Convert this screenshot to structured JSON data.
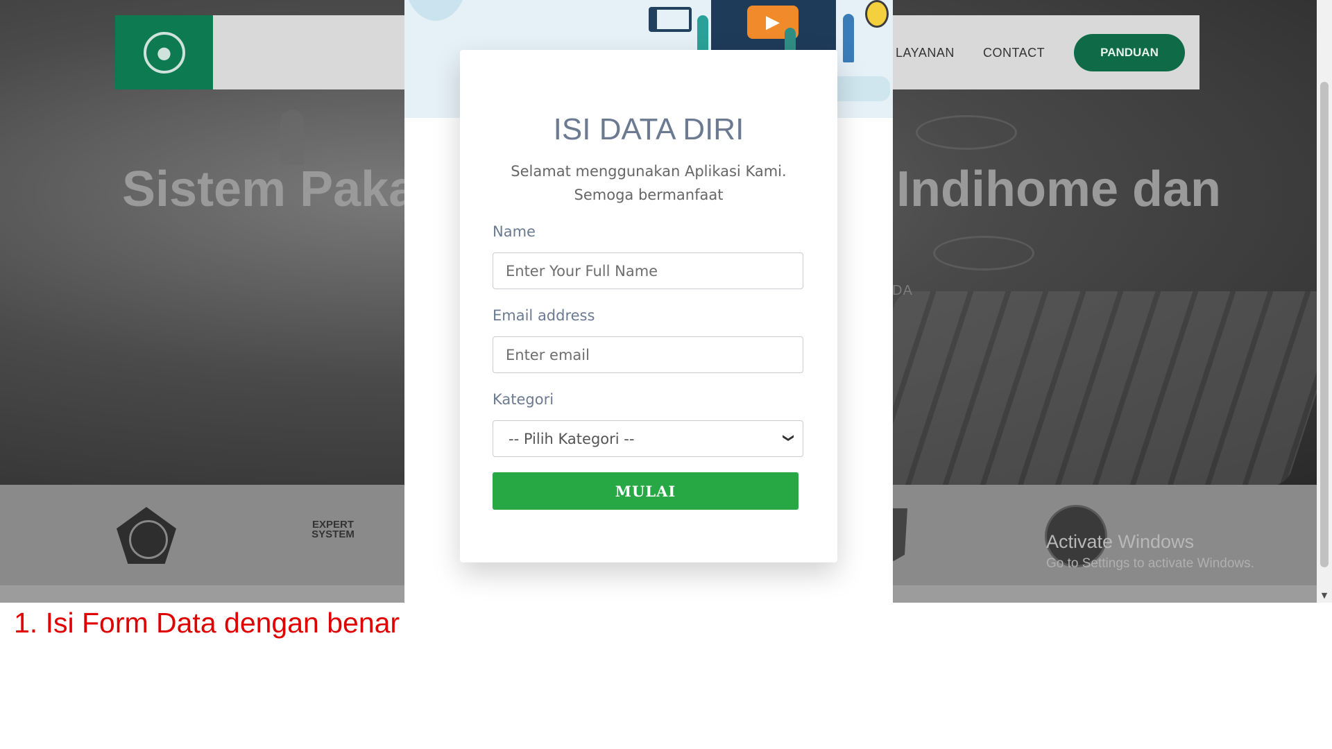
{
  "hero": {
    "title_left": "Sistem Pakar",
    "title_right": "Indihome dan",
    "subtitle_right": "DA"
  },
  "navbar": {
    "links": [
      "LAYANAN",
      "CONTACT"
    ],
    "cta_label": "PANDUAN"
  },
  "logos": {
    "expert_system_text": "EXPERT SYSTEM"
  },
  "modal": {
    "title": "ISI DATA DIRI",
    "subtitle": "Selamat menggunakan Aplikasi Kami. Semoga bermanfaat",
    "fields": {
      "name_label": "Name",
      "name_placeholder": "Enter Your Full Name",
      "email_label": "Email address",
      "email_placeholder": "Enter email",
      "kategori_label": "Kategori",
      "kategori_selected": "-- Pilih Kategori --"
    },
    "submit_label": "MULAI"
  },
  "windows_watermark": {
    "line1": "Activate Windows",
    "line2": "Go to Settings to activate Windows."
  },
  "caption": "1. Isi Form Data dengan benar",
  "colors": {
    "brand_green": "#0e7a52",
    "button_green": "#28a745",
    "caption_red": "#e00000",
    "title_slate": "#6b7a90"
  }
}
